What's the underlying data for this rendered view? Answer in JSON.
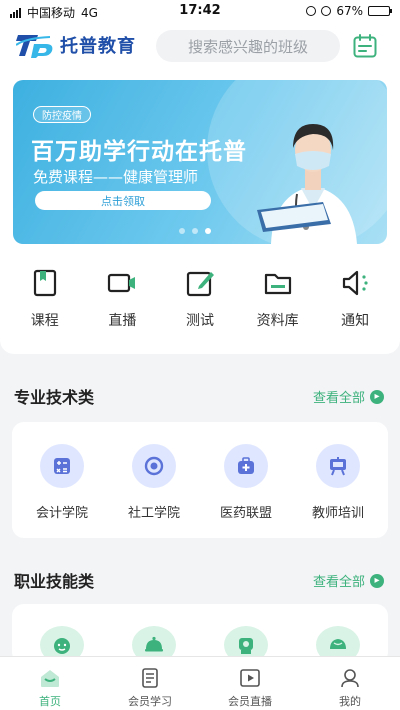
{
  "statusbar": {
    "carrier": "中国移动",
    "network": "4G",
    "time": "17:42",
    "battery": "67%",
    "battery_level": 0.67
  },
  "header": {
    "brand_abbr": "TP",
    "brand_name": "托普教育",
    "search_placeholder": "搜索感兴趣的班级"
  },
  "banner": {
    "tag": "防控疫情",
    "title": "百万助学行动在托普",
    "subtitle": "免费课程——健康管理师",
    "button": "点击领取",
    "slide_count": 3,
    "active_slide": 3
  },
  "quicknav": [
    {
      "label": "课程",
      "icon": "bookmark-book-icon"
    },
    {
      "label": "直播",
      "icon": "video-camera-icon"
    },
    {
      "label": "测试",
      "icon": "edit-pencil-icon"
    },
    {
      "label": "资料库",
      "icon": "folder-icon"
    },
    {
      "label": "通知",
      "icon": "speaker-icon"
    }
  ],
  "sections": [
    {
      "title": "专业技术类",
      "see_all": "查看全部",
      "items": [
        {
          "label": "会计学院",
          "icon": "calculator-icon",
          "color": "#dfe6ff",
          "fg": "#5b73d8"
        },
        {
          "label": "社工学院",
          "icon": "target-icon",
          "color": "#dfe6ff",
          "fg": "#5b73d8"
        },
        {
          "label": "医药联盟",
          "icon": "medkit-icon",
          "color": "#dfe6ff",
          "fg": "#5b73d8"
        },
        {
          "label": "教师培训",
          "icon": "easel-icon",
          "color": "#dfe6ff",
          "fg": "#5b73d8"
        }
      ]
    },
    {
      "title": "职业技能类",
      "see_all": "查看全部",
      "items": [
        {
          "label": "",
          "icon": "baby-face-icon",
          "color": "#d9f3e6",
          "fg": "#3db27d"
        },
        {
          "label": "",
          "icon": "cloche-icon",
          "color": "#d9f3e6",
          "fg": "#3db27d"
        },
        {
          "label": "",
          "icon": "worker-icon",
          "color": "#d9f3e6",
          "fg": "#3db27d"
        },
        {
          "label": "",
          "icon": "bun-icon",
          "color": "#d9f3e6",
          "fg": "#3db27d"
        }
      ]
    }
  ],
  "tabbar": [
    {
      "label": "首页",
      "icon": "home-icon",
      "active": true
    },
    {
      "label": "会员学习",
      "icon": "book-icon",
      "active": false
    },
    {
      "label": "会员直播",
      "icon": "play-video-icon",
      "active": false
    },
    {
      "label": "我的",
      "icon": "user-icon",
      "active": false
    }
  ],
  "colors": {
    "accent": "#3db27d",
    "brand": "#1f4fa8",
    "banner": "#3db0e0"
  }
}
